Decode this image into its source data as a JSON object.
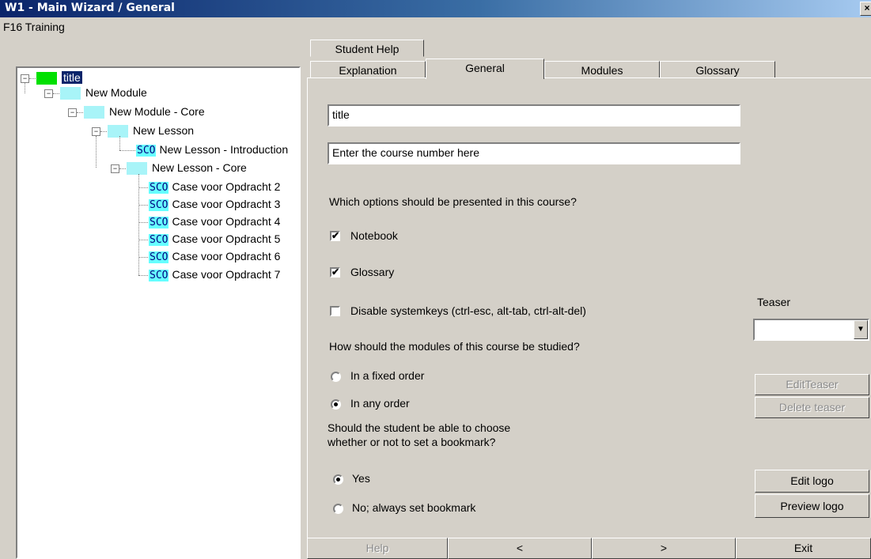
{
  "window": {
    "title": "W1 - Main Wizard / General",
    "close_glyph": "×"
  },
  "course_label": "F16 Training",
  "tree": {
    "root": "title",
    "items": [
      {
        "label": "New Module",
        "type": "folder"
      },
      {
        "label": "New Module - Core",
        "type": "folder"
      },
      {
        "label": "New Lesson",
        "type": "folder"
      },
      {
        "label": "New Lesson - Introduction",
        "type": "sco"
      },
      {
        "label": "New Lesson - Core",
        "type": "folder"
      },
      {
        "label": "Case voor Opdracht 2",
        "type": "sco"
      },
      {
        "label": "Case voor Opdracht 3",
        "type": "sco"
      },
      {
        "label": "Case voor Opdracht 4",
        "type": "sco"
      },
      {
        "label": "Case voor Opdracht 5",
        "type": "sco"
      },
      {
        "label": "Case voor Opdracht 6",
        "type": "sco"
      },
      {
        "label": "Case voor Opdracht 7",
        "type": "sco"
      }
    ],
    "sco_tag": "SCO",
    "expand_glyph": "−"
  },
  "tabs": {
    "student_help": "Student Help",
    "explanation": "Explanation",
    "general": "General",
    "modules": "Modules",
    "glossary": "Glossary",
    "active": "General"
  },
  "form": {
    "title_value": "title",
    "course_number_value": "Enter the course number here",
    "options_question": "Which options should be presented in this course?",
    "notebook_label": "Notebook",
    "notebook_checked": true,
    "glossary_label": "Glossary",
    "glossary_checked": true,
    "disable_keys_label": "Disable systemkeys (ctrl-esc, alt-tab, ctrl-alt-del)",
    "disable_keys_checked": false,
    "check_glyph": "✔",
    "order_question": "How should the modules of this course be studied?",
    "fixed_order_label": "In a fixed order",
    "any_order_label": "In any order",
    "order_selected": "In any order",
    "bookmark_question_line1": "Should the student be able to choose",
    "bookmark_question_line2": "whether or not to set a bookmark?",
    "yes_label": "Yes",
    "no_label": "No; always set bookmark",
    "bookmark_selected": "Yes"
  },
  "teaser": {
    "label": "Teaser",
    "selected_value": "",
    "arrow_glyph": "▼",
    "edit_label": "EditTeaser",
    "delete_label": "Delete teaser"
  },
  "logo": {
    "edit_label": "Edit logo",
    "preview_label": "Preview logo"
  },
  "footer": {
    "help": "Help",
    "prev": "<",
    "next": ">",
    "exit": "Exit"
  },
  "colors": {
    "title_bar": "#0a246a",
    "face": "#d4d0c8",
    "root_node": "#00e000",
    "folder_node": "#a8f4f8",
    "sco_tag_bg": "#66ffff"
  }
}
